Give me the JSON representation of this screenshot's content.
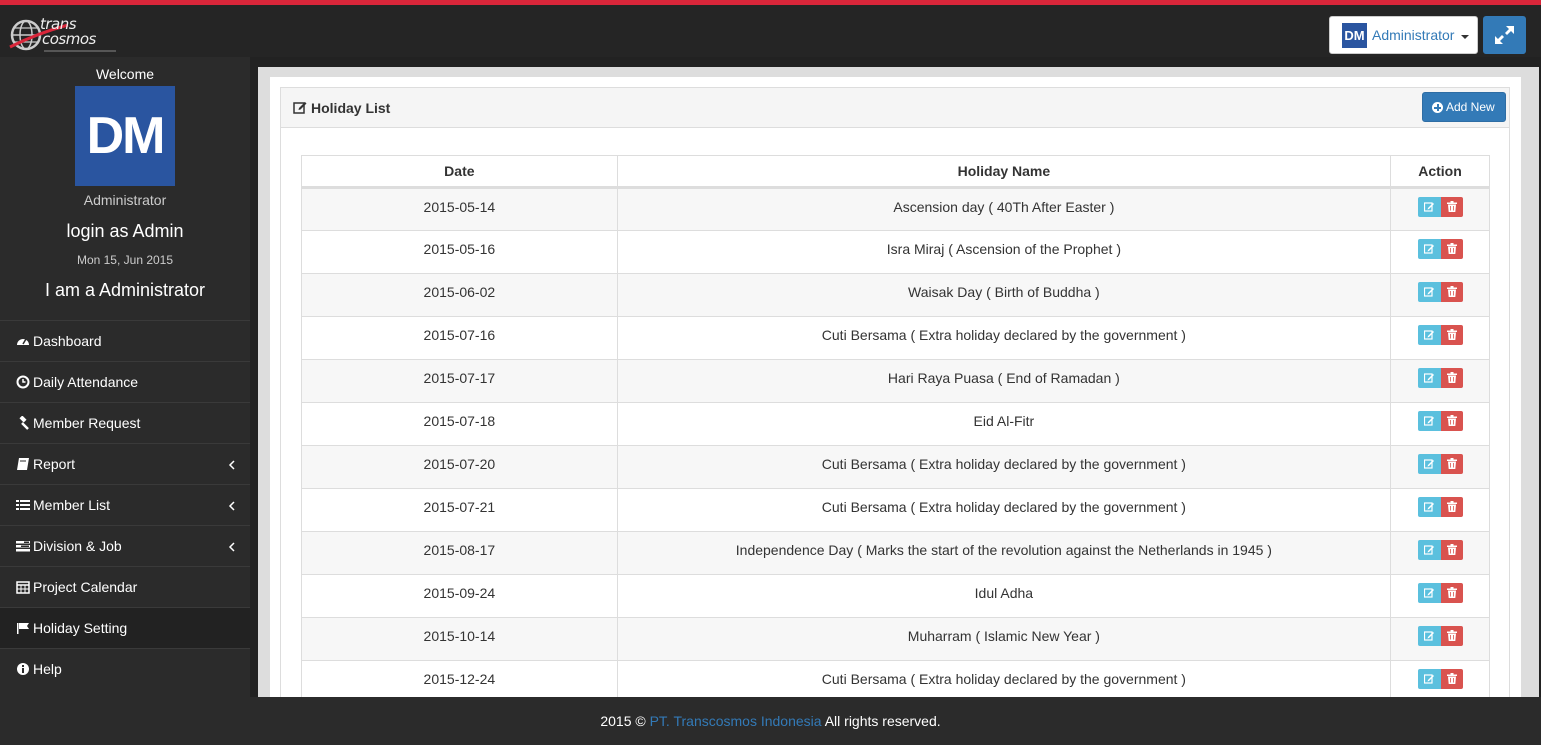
{
  "header": {
    "logo_text_1": "trans",
    "logo_text_2": "cosmos",
    "user_avatar_initials": "DM",
    "user_name": "Administrator"
  },
  "sidebar": {
    "welcome": "Welcome",
    "avatar_initials": "DM",
    "role": "Administrator",
    "login_as": "login as Admin",
    "date": "Mon 15, Jun 2015",
    "iam": "I am a Administrator",
    "items": [
      {
        "label": "Dashboard",
        "icon": "dashboard-icon"
      },
      {
        "label": "Daily Attendance",
        "icon": "clock-icon"
      },
      {
        "label": "Member Request",
        "icon": "gavel-icon"
      },
      {
        "label": "Report",
        "icon": "book-icon"
      },
      {
        "label": "Member List",
        "icon": "list-icon"
      },
      {
        "label": "Division & Job",
        "icon": "tasks-icon"
      },
      {
        "label": "Project Calendar",
        "icon": "calendar-icon"
      },
      {
        "label": "Holiday Setting",
        "icon": "flag-icon"
      },
      {
        "label": "Help",
        "icon": "info-icon"
      }
    ]
  },
  "panel": {
    "title": "Holiday List",
    "add_label": "Add New"
  },
  "table": {
    "headers": [
      "Date",
      "Holiday Name",
      "Action"
    ],
    "rows": [
      {
        "date": "2015-05-14",
        "name": "Ascension day ( 40Th After Easter )"
      },
      {
        "date": "2015-05-16",
        "name": "Isra Miraj ( Ascension of the Prophet )"
      },
      {
        "date": "2015-06-02",
        "name": "Waisak Day ( Birth of Buddha )"
      },
      {
        "date": "2015-07-16",
        "name": "Cuti Bersama ( Extra holiday declared by the government )"
      },
      {
        "date": "2015-07-17",
        "name": "Hari Raya Puasa ( End of Ramadan )"
      },
      {
        "date": "2015-07-18",
        "name": "Eid Al-Fitr"
      },
      {
        "date": "2015-07-20",
        "name": "Cuti Bersama ( Extra holiday declared by the government )"
      },
      {
        "date": "2015-07-21",
        "name": "Cuti Bersama ( Extra holiday declared by the government )"
      },
      {
        "date": "2015-08-17",
        "name": "Independence Day ( Marks the start of the revolution against the Netherlands in 1945 )"
      },
      {
        "date": "2015-09-24",
        "name": "Idul Adha"
      },
      {
        "date": "2015-10-14",
        "name": "Muharram ( Islamic New Year )"
      },
      {
        "date": "2015-12-24",
        "name": "Cuti Bersama ( Extra holiday declared by the government )"
      }
    ]
  },
  "footer": {
    "prefix": "2015 ©",
    "company": "PT. Transcosmos Indonesia",
    "suffix": "All rights reserved."
  },
  "colors": {
    "accent_red": "#d9263a",
    "primary": "#337ab7",
    "info": "#5bc0de",
    "danger": "#d9534f",
    "avatar": "#2a55a0"
  }
}
